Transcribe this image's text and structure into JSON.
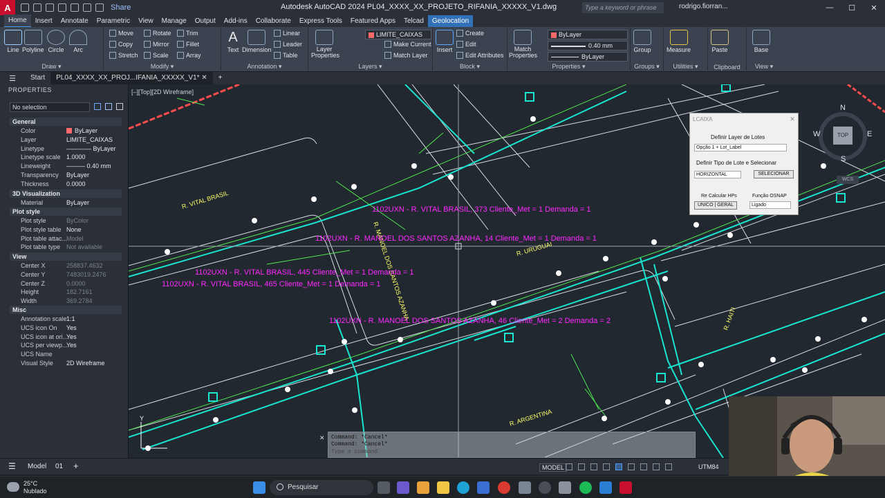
{
  "title_bar": {
    "app_logo": "A",
    "share_label": "Share",
    "window_title": "Autodesk AutoCAD 2024   PL04_XXXX_XX_PROJETO_RIFANIA_XXXXX_V1.dwg",
    "search_placeholder": "Type a keyword or phrase",
    "user": "rodrigo.fiorran...",
    "minimize": "—",
    "maximize": "☐",
    "close": "✕"
  },
  "ribbon_tabs": [
    "Home",
    "Insert",
    "Annotate",
    "Parametric",
    "View",
    "Manage",
    "Output",
    "Add-ins",
    "Collaborate",
    "Express Tools",
    "Featured Apps",
    "Telcad",
    "Geolocation"
  ],
  "ribbon": {
    "draw": {
      "title": "Draw ▾",
      "line": "Line",
      "polyline": "Polyline",
      "circle": "Circle",
      "arc": "Arc"
    },
    "modify": {
      "title": "Modify ▾",
      "move": "Move",
      "rotate": "Rotate",
      "trim": "Trim",
      "copy": "Copy",
      "mirror": "Mirror",
      "fillet": "Fillet",
      "stretch": "Stretch",
      "scale": "Scale",
      "array": "Array"
    },
    "annotation": {
      "title": "Annotation ▾",
      "text": "Text",
      "dimension": "Dimension",
      "linear": "Linear",
      "leader": "Leader",
      "table": "Table"
    },
    "layers": {
      "title": "Layers ▾",
      "layer_properties": "Layer Properties",
      "current_layer": "LIMITE_CAIXAS",
      "make_current": "Make Current",
      "match_layer": "Match Layer"
    },
    "block": {
      "title": "Block ▾",
      "insert": "Insert",
      "create": "Create",
      "edit": "Edit",
      "edit_attributes": "Edit Attributes"
    },
    "properties": {
      "title": "Properties ▾",
      "match": "Match Properties",
      "color": "ByLayer",
      "lineweight": "0.40 mm",
      "linetype": "ByLayer"
    },
    "groups": {
      "title": "Groups ▾",
      "group": "Group"
    },
    "utilities": {
      "title": "Utilities ▾",
      "measure": "Measure"
    },
    "clipboard": {
      "title": "Clipboard",
      "paste": "Paste"
    },
    "view": {
      "title": "View ▾",
      "base": "Base"
    }
  },
  "file_tabs": {
    "start": "Start",
    "active": "PL04_XXXX_XX_PROJ...IFANIA_XXXXX_V1*",
    "add": "+"
  },
  "properties_palette": {
    "title": "PROPERTIES",
    "selection": "No selection",
    "sections": {
      "general": "General",
      "visualization": "3D Visualization",
      "plot_style": "Plot style",
      "view": "View",
      "misc": "Misc"
    },
    "general": [
      {
        "k": "Color",
        "v": "ByLayer"
      },
      {
        "k": "Layer",
        "v": "LIMITE_CAIXAS"
      },
      {
        "k": "Linetype",
        "v": "———— ByLayer"
      },
      {
        "k": "Linetype scale",
        "v": "1.0000"
      },
      {
        "k": "Lineweight",
        "v": "——— 0.40 mm"
      },
      {
        "k": "Transparency",
        "v": "ByLayer"
      },
      {
        "k": "Thickness",
        "v": "0.0000"
      }
    ],
    "visualization": [
      {
        "k": "Material",
        "v": "ByLayer"
      }
    ],
    "plot_style": [
      {
        "k": "Plot style",
        "v": "ByColor"
      },
      {
        "k": "Plot style table",
        "v": "None"
      },
      {
        "k": "Plot table attac...",
        "v": "Model"
      },
      {
        "k": "Plot table type",
        "v": "Not available"
      }
    ],
    "view": [
      {
        "k": "Center X",
        "v": "258837.4632"
      },
      {
        "k": "Center Y",
        "v": "7483019.2476"
      },
      {
        "k": "Center Z",
        "v": "0.0000"
      },
      {
        "k": "Height",
        "v": "182.7161"
      },
      {
        "k": "Width",
        "v": "369.2784"
      }
    ],
    "misc": [
      {
        "k": "Annotation scale",
        "v": "1:1"
      },
      {
        "k": "UCS icon On",
        "v": "Yes"
      },
      {
        "k": "UCS icon at ori...",
        "v": "Yes"
      },
      {
        "k": "UCS per viewp...",
        "v": "Yes"
      },
      {
        "k": "UCS Name",
        "v": ""
      },
      {
        "k": "Visual Style",
        "v": "2D Wireframe"
      }
    ]
  },
  "viewport_label": "[–][Top][2D Wireframe]",
  "drawing_labels": {
    "streets": [
      "R. VITAL BRASIL",
      "R. MANOEL DOS SANTOS AZANHA",
      "R. URUGUAI",
      "R. ARGENTINA",
      "R. HAITI"
    ],
    "annotations": [
      "1102UXN - R. VITAL BRASIL, 373 Cliente_Met = 1  Demanda = 1",
      "1102UXN - R. MANOEL DOS SANTOS AZANHA, 14 Cliente_Met = 1  Demanda = 1",
      "1102UXN - R. VITAL BRASIL, 445 Cliente_Met = 1  Demanda = 1",
      "1102UXN - R. VITAL BRASIL, 465 Cliente_Met = 1  Demanda = 1",
      "1102UXN - R. MANOEL DOS SANTOS AZANHA, 46 Cliente_Met = 2  Demanda = 2"
    ]
  },
  "viewcube": {
    "n": "N",
    "s": "S",
    "e": "E",
    "w": "W",
    "top": "TOP",
    "wcs": "WCS"
  },
  "lcaixa_dialog": {
    "title": "LCAIXA",
    "close": "✕",
    "label_layer": "Definir Layer de Lotes",
    "layer_option": "Opção 1 + Lot_Label",
    "label_tipo": "Definir Tipo de Lote e Selecionar",
    "tipo_option": "HORIZONTAL",
    "btn_select": "SELECIONAR",
    "label_recalc": "Re Calcular HPs",
    "recalc_option": "UNICO | GERAL",
    "label_osnap": "Função OSNAP",
    "osnap_option": "Ligado"
  },
  "command_line": {
    "line1": "Command: *Cancel*",
    "line2": "Command: *Cancel*",
    "placeholder": "Type a command"
  },
  "status_bar": {
    "model_tab": "Model",
    "layout_tab": "01",
    "model": "MODEL",
    "coords": "UTM84"
  },
  "taskbar": {
    "weather_temp": "25°C",
    "weather_desc": "Nublado",
    "search": "Pesquisar"
  },
  "colors": {
    "drawing_bg": "#212830",
    "cyan": "#19e5d0",
    "green": "#4ee64e",
    "magenta": "#ff29ff",
    "yellow": "#ffff66",
    "red": "#ff4d4d",
    "accent": "#3271b8"
  }
}
